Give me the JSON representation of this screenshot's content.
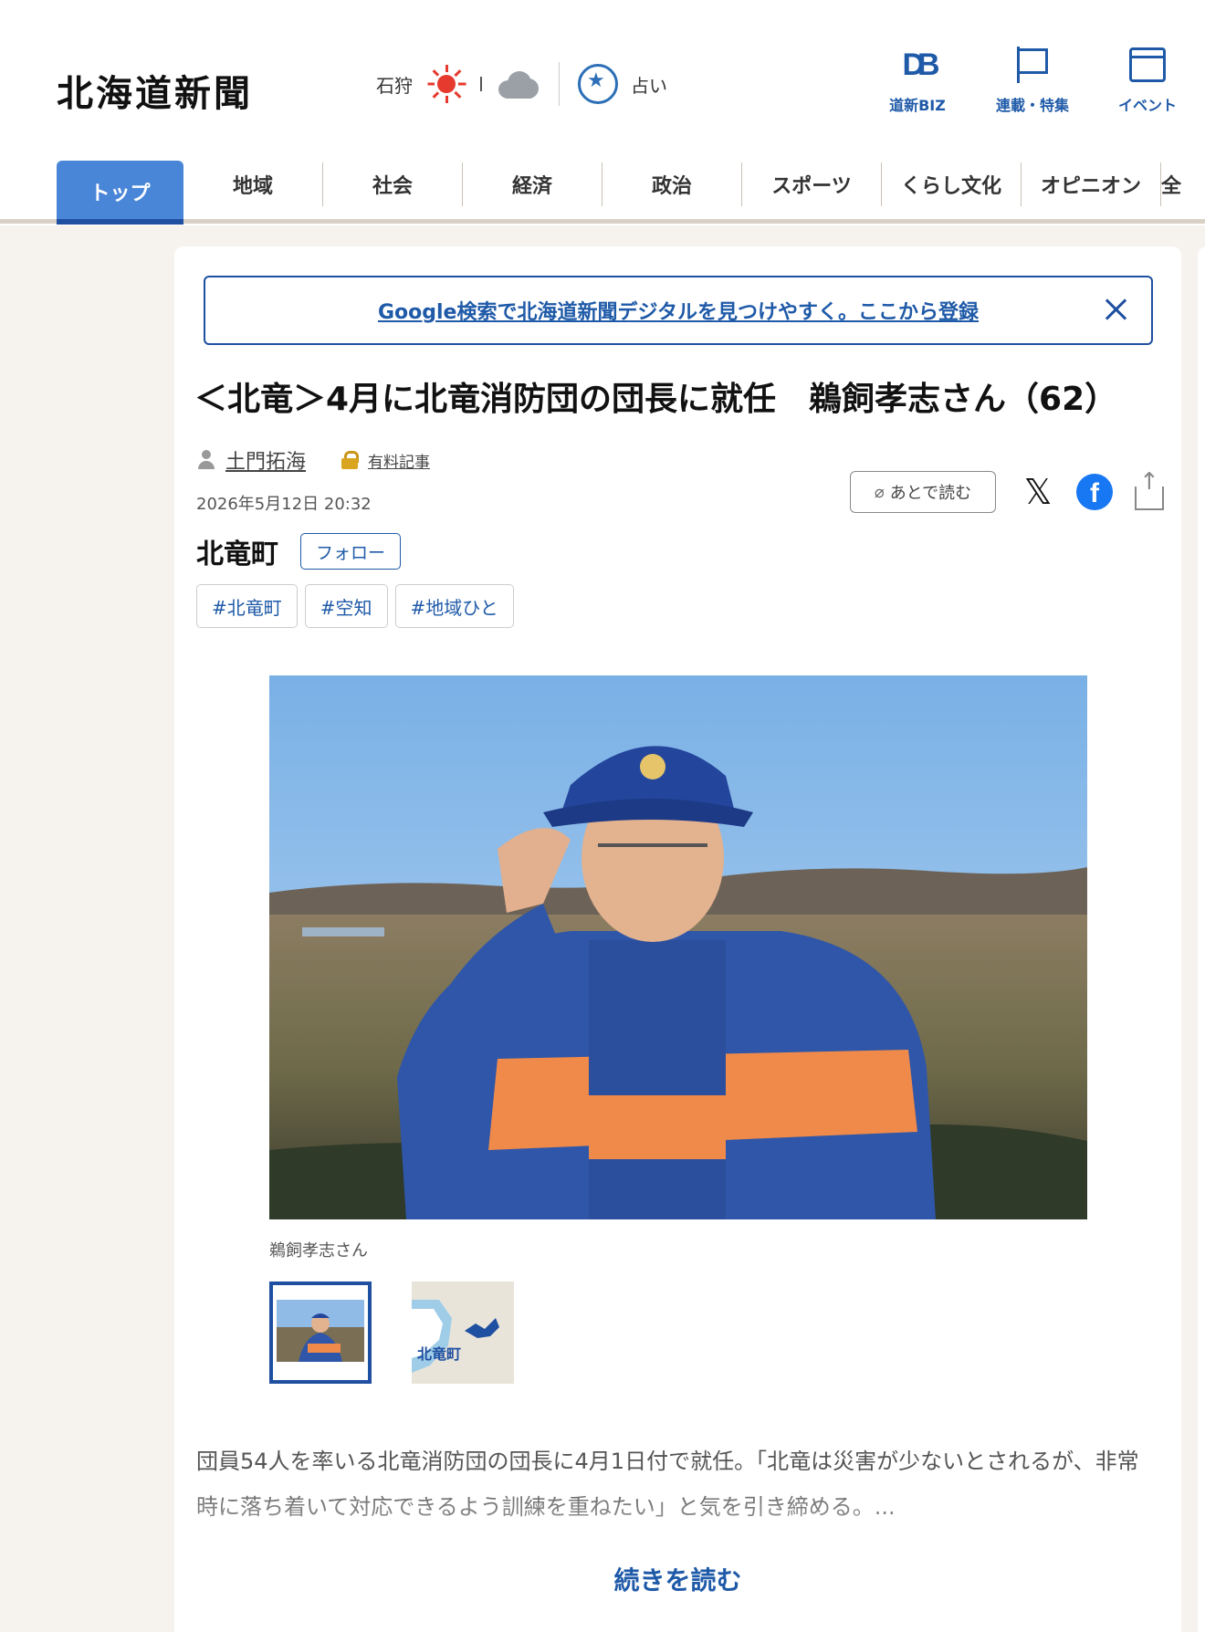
{
  "header": {
    "logo": "北海道新聞",
    "weather": {
      "prefecture": "石狩",
      "icons": [
        "sun-icon",
        "cloud-icon"
      ]
    },
    "fortune_label": "占い",
    "top_links": [
      {
        "label": "道新BIZ",
        "icon": "db-icon"
      },
      {
        "label": "連載・特集",
        "icon": "flag-icon"
      },
      {
        "label": "イベント",
        "icon": "calendar-icon"
      }
    ]
  },
  "nav": {
    "categories": [
      "トップ",
      "地域",
      "社会",
      "経済",
      "政治",
      "スポーツ",
      "くらし文化",
      "オピニオン",
      "全"
    ],
    "active": "トップ"
  },
  "banner": {
    "text": "Google検索で北海道新聞デジタルを見つけやすく。ここから登録"
  },
  "article": {
    "headline": "＜北竜＞4月に北竜消防団の団長に就任　鵜飼孝志さん（62）",
    "author": "土門拓海",
    "paid_label": "有料記事",
    "date": "2026年5月12日 20:32",
    "read_later": "あとで読む",
    "area": "北竜町",
    "follow": "フォロー",
    "tags": [
      "#北竜町",
      "#空知",
      "#地域ひと"
    ],
    "photo_caption": "鵜飼孝志さん",
    "thumb_map_label": "北竜町",
    "body": "団員54人を率いる北竜消防団の団長に4月1日付で就任。「北竜は災害が少ないとされるが、非常時に落ち着いて対応できるよう訓練を重ねたい」と気を引き締める。...",
    "read_more": "続きを読む"
  },
  "colors": {
    "accent": "#1f5aa8",
    "nav_active": "#4a86d8",
    "background": "#f6f3ef",
    "paid_lock": "#d9a520",
    "facebook": "#1877f2"
  }
}
